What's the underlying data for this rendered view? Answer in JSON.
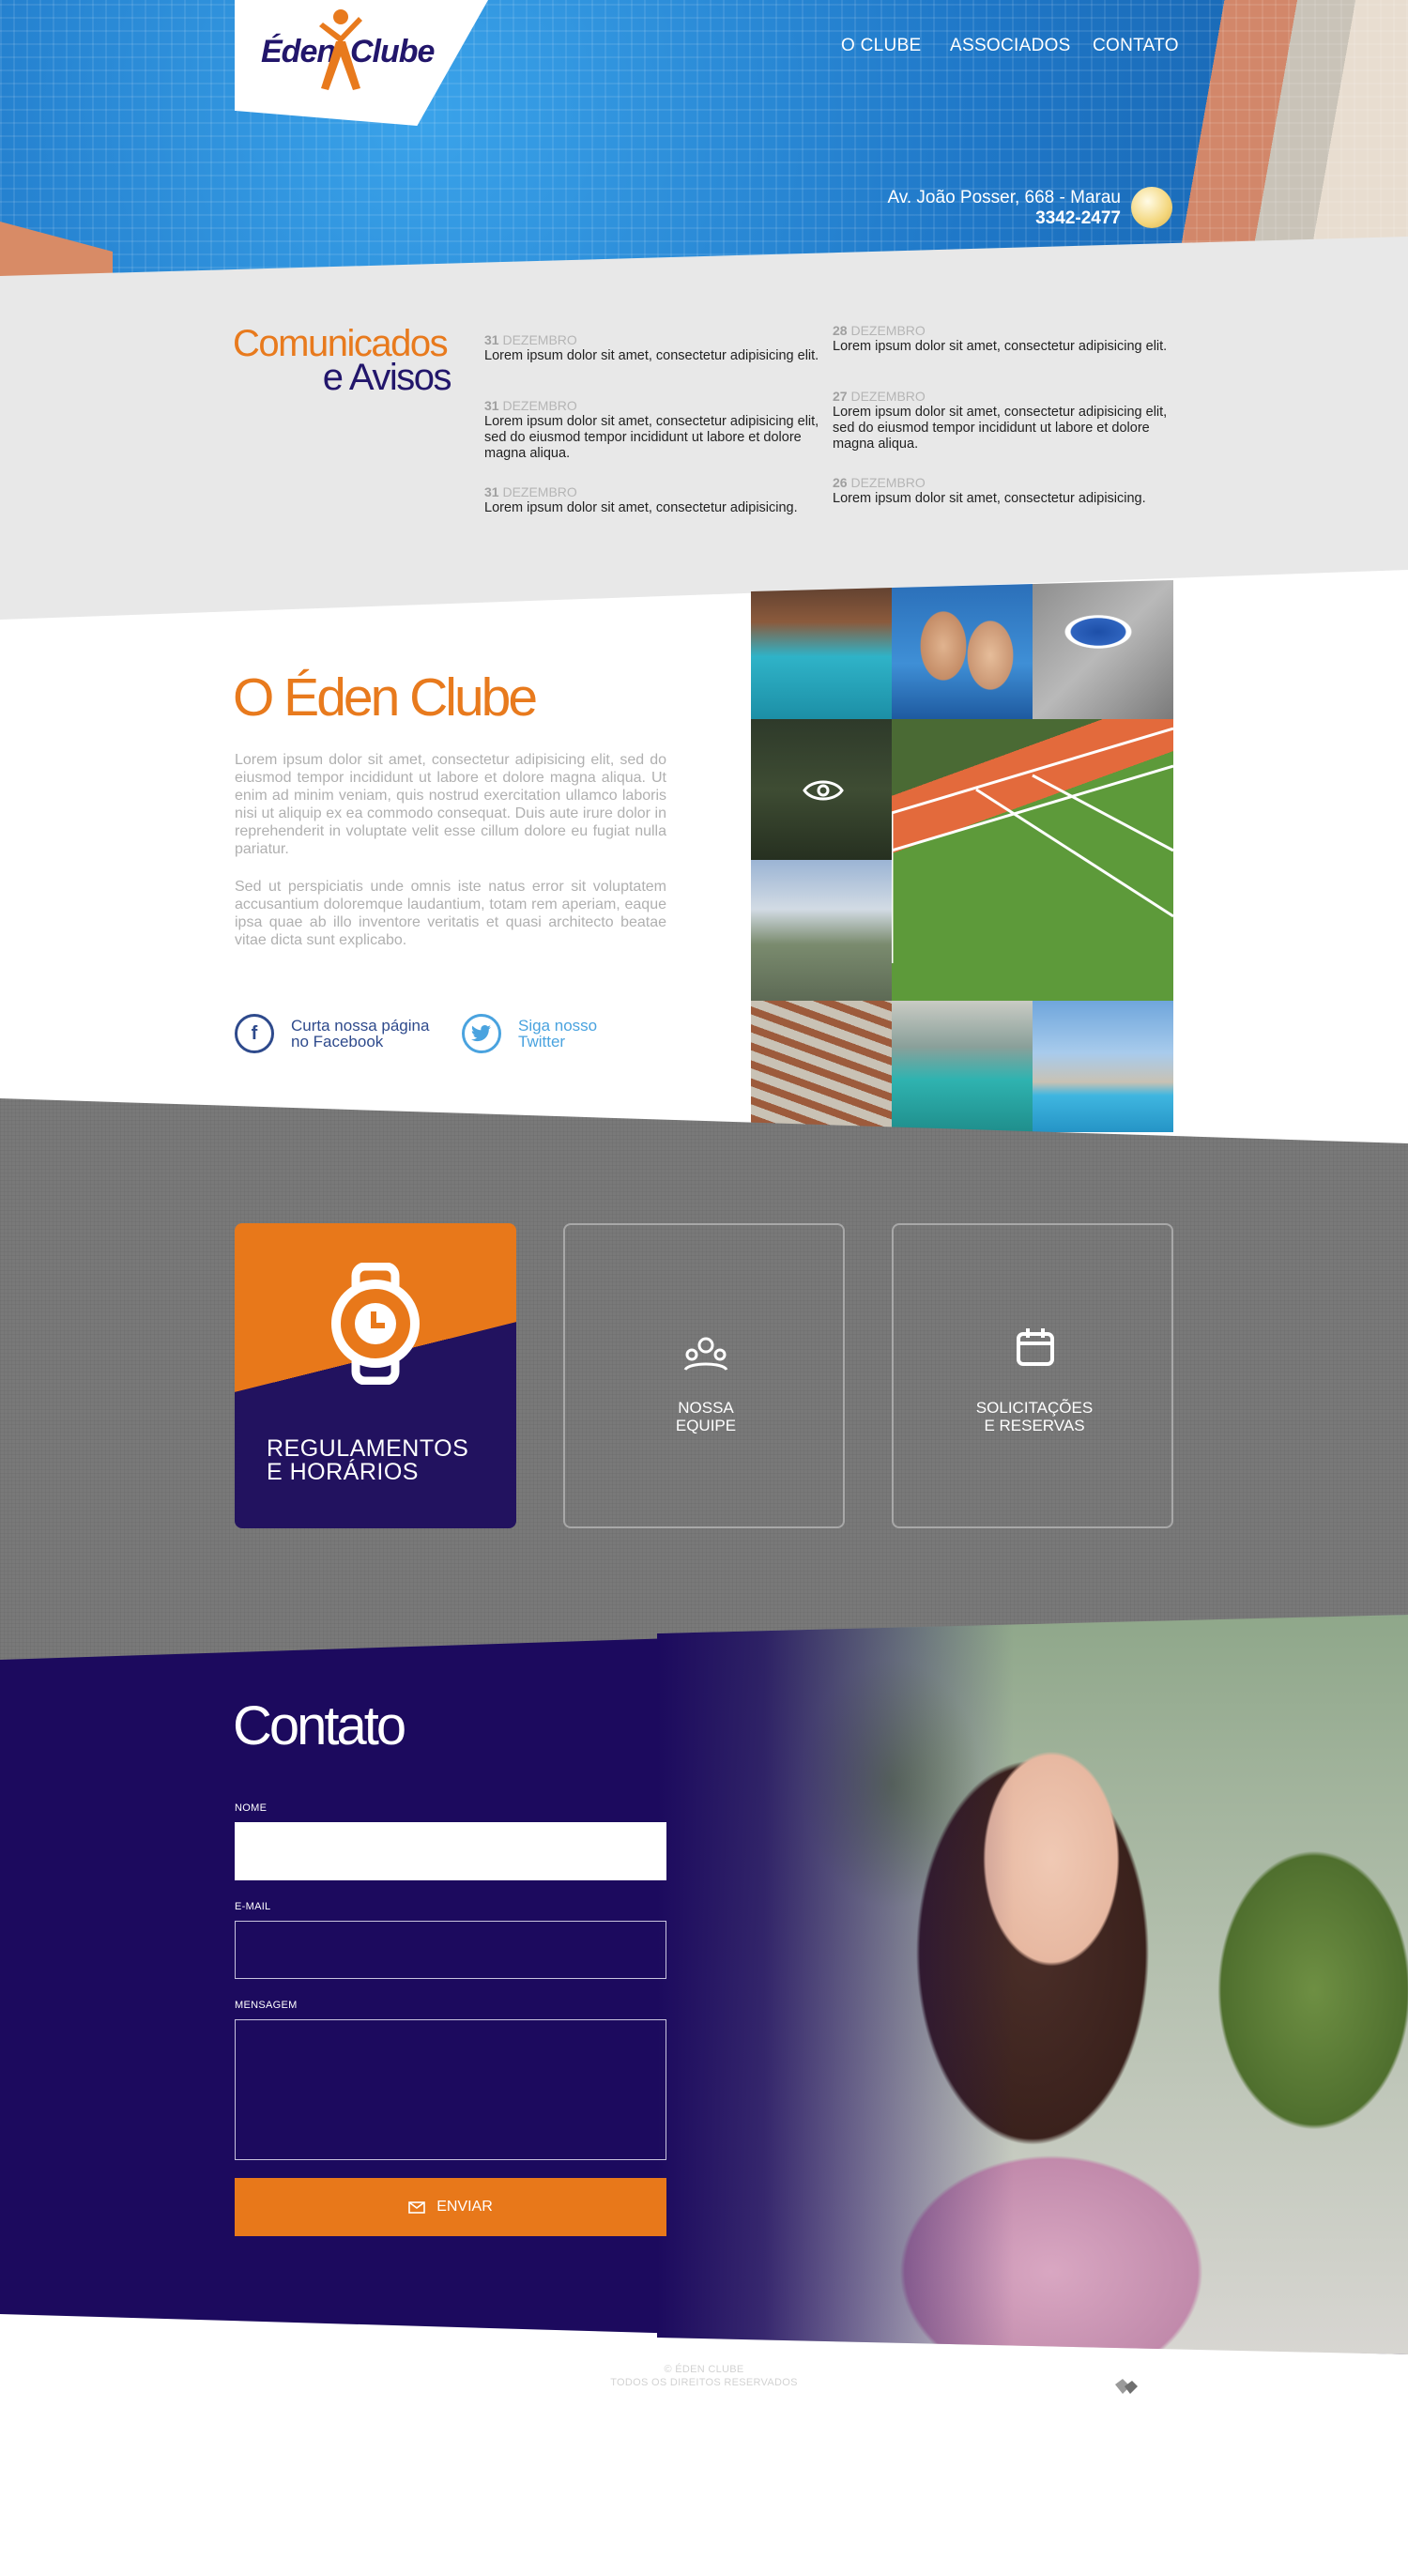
{
  "brand": {
    "logo_left": "Éden",
    "logo_right": "Clube",
    "orange": "#e87a1d",
    "navy": "#22166b"
  },
  "nav": {
    "items": [
      "O CLUBE",
      "ASSOCIADOS",
      "CONTATO"
    ]
  },
  "header": {
    "address": "Av. João Posser, 668 - Marau",
    "phone": "3342-2477"
  },
  "notices": {
    "title_line1": "Comunicados",
    "title_line2": "e Avisos",
    "col1": [
      {
        "day": "31",
        "month": "DEZEMBRO",
        "text": "Lorem ipsum dolor sit amet, consectetur adipisicing elit."
      },
      {
        "day": "31",
        "month": "DEZEMBRO",
        "text": "Lorem ipsum dolor sit amet, consectetur adipisicing elit, sed do eiusmod tempor incididunt ut labore et dolore magna aliqua."
      },
      {
        "day": "31",
        "month": "DEZEMBRO",
        "text": "Lorem ipsum dolor sit amet, consectetur adipisicing."
      }
    ],
    "col2": [
      {
        "day": "28",
        "month": "DEZEMBRO",
        "text": "Lorem ipsum dolor sit amet, consectetur adipisicing elit."
      },
      {
        "day": "27",
        "month": "DEZEMBRO",
        "text": "Lorem ipsum dolor sit amet, consectetur adipisicing elit, sed do eiusmod tempor incididunt ut labore et dolore magna aliqua."
      },
      {
        "day": "26",
        "month": "DEZEMBRO",
        "text": "Lorem ipsum dolor sit amet, consectetur adipisicing."
      }
    ]
  },
  "about": {
    "title": "O Éden Clube",
    "p1": "Lorem ipsum dolor sit amet, consectetur adipisicing elit, sed do eiusmod tempor incididunt ut labore et dolore magna aliqua. Ut enim ad minim veniam, quis nostrud exercitation ullamco laboris nisi ut aliquip ex ea commodo consequat. Duis aute irure dolor in reprehenderit in voluptate velit esse cillum dolore eu fugiat nulla pariatur.",
    "p2": "Sed ut perspiciatis unde omnis iste natus error sit voluptatem accusantium doloremque laudantium, totam rem aperiam, eaque ipsa quae ab illo inventore veritatis et quasi architecto beatae vitae dicta sunt explicabo.",
    "facebook_line1": "Curta nossa página",
    "facebook_line2": "no Facebook",
    "twitter_line1": "Siga nosso",
    "twitter_line2": "Twitter",
    "facebook_color": "#2e4a8c",
    "twitter_color": "#4aa3df"
  },
  "services": {
    "reg_line1": "REGULAMENTOS",
    "reg_line2": "E HORÁRIOS",
    "team_line1": "NOSSA",
    "team_line2": "EQUIPE",
    "req_line1": "SOLICITAÇÕES",
    "req_line2": "E RESERVAS"
  },
  "contact": {
    "title": "Contato",
    "name_label": "NOME",
    "email_label": "E-MAIL",
    "message_label": "MENSAGEM",
    "name_value": "",
    "send_label": "ENVIAR"
  },
  "footer": {
    "line1": "© ÉDEN CLUBE",
    "line2": "TODOS OS DIREITOS RESERVADOS"
  }
}
